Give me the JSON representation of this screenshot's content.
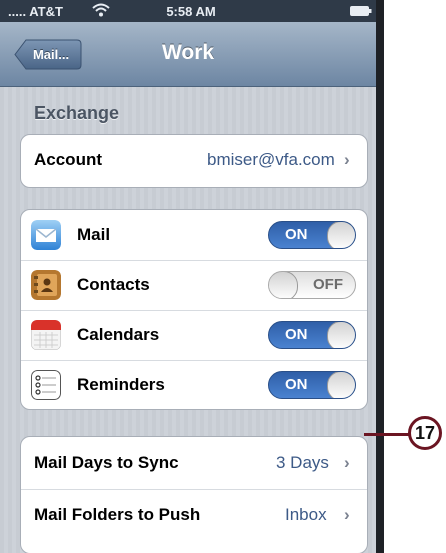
{
  "status_bar": {
    "carrier": "AT&T",
    "time": "5:58 AM"
  },
  "nav": {
    "back_label": "Mail...",
    "title": "Work"
  },
  "section_header": "Exchange",
  "account": {
    "label": "Account",
    "value": "bmiser@vfa.com"
  },
  "services": [
    {
      "label": "Mail",
      "icon": "mail-icon",
      "state": "ON"
    },
    {
      "label": "Contacts",
      "icon": "contacts-icon",
      "state": "OFF"
    },
    {
      "label": "Calendars",
      "icon": "calendar-icon",
      "state": "ON"
    },
    {
      "label": "Reminders",
      "icon": "reminders-icon",
      "state": "ON"
    }
  ],
  "sync": [
    {
      "label": "Mail Days to Sync",
      "value": "3 Days"
    },
    {
      "label": "Mail Folders to Push",
      "value": "Inbox"
    }
  ],
  "callout": {
    "number": "17"
  },
  "colors": {
    "nav_bar": "#6d86a3",
    "toggle_on": "#3a6fc0",
    "value_text": "#3d5a87",
    "callout": "#6b1522"
  }
}
